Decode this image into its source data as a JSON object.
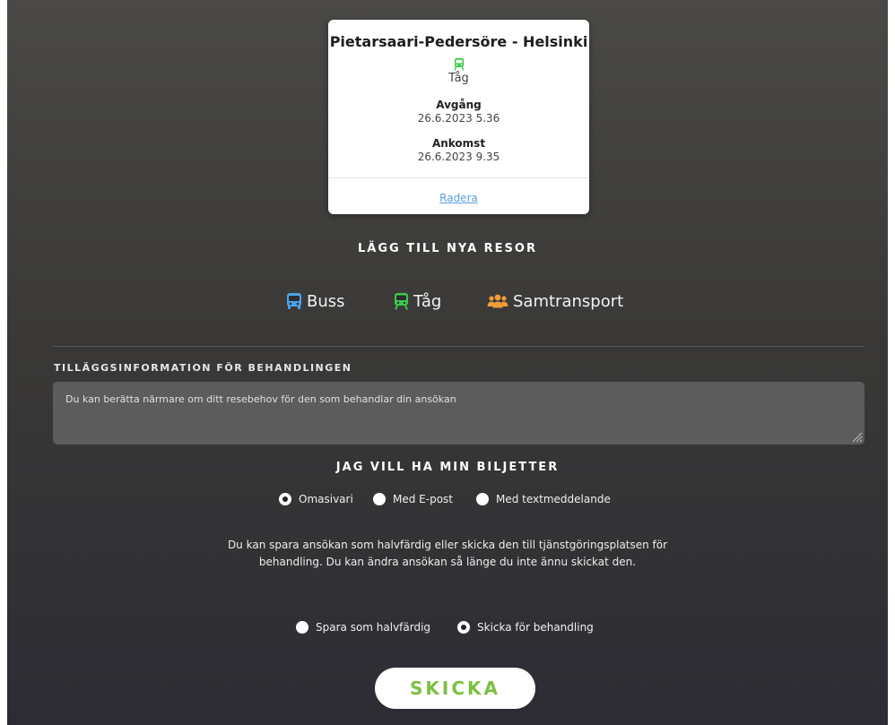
{
  "colors": {
    "bus_icon": "#4aa3e8",
    "train_icon": "#3ec94a",
    "group_icon": "#f29b38",
    "send_text": "#7bc043",
    "link": "#5aa0dc"
  },
  "trip": {
    "route": "Pietarsaari-Pedersöre - Helsinki",
    "mode_icon": "train-icon",
    "mode": "Tåg",
    "departure_label": "Avgång",
    "departure_value": "26.6.2023 5.36",
    "arrival_label": "Ankomst",
    "arrival_value": "26.6.2023 9.35",
    "delete_label": "Radera"
  },
  "add_trips": {
    "title": "LÄGG TILL NYA RESOR",
    "modes": [
      {
        "icon": "bus-icon",
        "label": "Buss"
      },
      {
        "icon": "train-icon",
        "label": "Tåg"
      },
      {
        "icon": "group-icon",
        "label": "Samtransport"
      }
    ]
  },
  "additional_info": {
    "label": "TILLÄGGSINFORMATION FÖR BEHANDLINGEN",
    "placeholder": "Du kan berätta närmare om ditt resebehov för den som behandlar din ansökan"
  },
  "tickets": {
    "title": "JAG VILL HA MIN BILJETTER",
    "options": [
      {
        "label": "Omasivari",
        "selected": true
      },
      {
        "label": "Med E-post",
        "selected": false
      },
      {
        "label": "Med textmeddelande",
        "selected": false
      }
    ]
  },
  "save_info": {
    "text": "Du kan spara ansökan som halvfärdig eller skicka den till tjänstgöringsplatsen för behandling. Du kan ändra ansökan så länge du inte ännu skickat den."
  },
  "submit_mode": {
    "options": [
      {
        "label": "Spara som halvfärdig",
        "selected": false
      },
      {
        "label": "Skicka för behandling",
        "selected": true
      }
    ]
  },
  "send_button": {
    "label": "SKICKA"
  }
}
